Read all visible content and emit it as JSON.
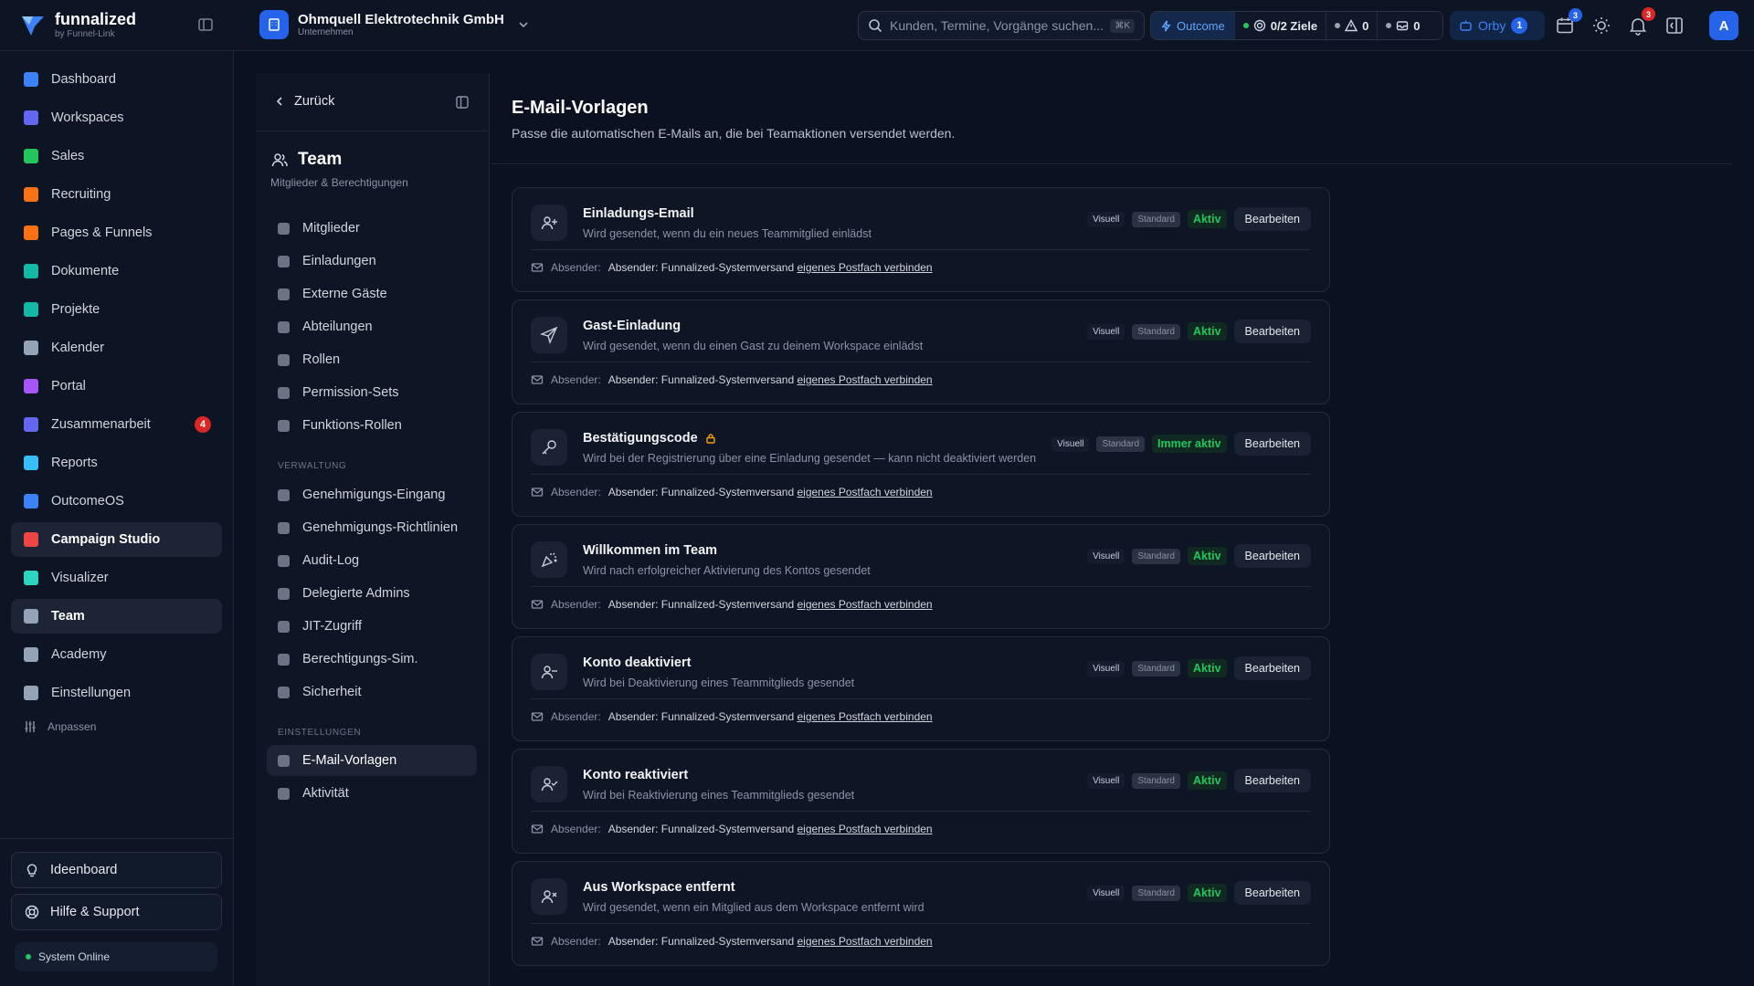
{
  "brand": {
    "name": "funnalized",
    "sub": "by Funnel-Link"
  },
  "company": {
    "name": "Ohmquell Elektrotechnik GmbH",
    "type": "Unternehmen"
  },
  "search": {
    "placeholder": "Kunden, Termine, Vorgänge suchen...",
    "shortcut": "⌘K"
  },
  "status": {
    "outcome_label": "Outcome",
    "goals": "0/2 Ziele",
    "warnings": "0",
    "messages": "0"
  },
  "orby": {
    "label": "Orby",
    "count": "1"
  },
  "top_badges": {
    "calendar": "3",
    "notifications": "3"
  },
  "user": {
    "avatar": "A"
  },
  "sidebar": {
    "items": [
      {
        "label": "Dashboard",
        "icon": "dashboard-icon",
        "color": "#3b82f6"
      },
      {
        "label": "Workspaces",
        "icon": "workspaces-icon",
        "color": "#6366f1"
      },
      {
        "label": "Sales",
        "icon": "sales-icon",
        "color": "#22c55e"
      },
      {
        "label": "Recruiting",
        "icon": "recruiting-icon",
        "color": "#f97316"
      },
      {
        "label": "Pages & Funnels",
        "icon": "funnel-icon",
        "color": "#f97316"
      },
      {
        "label": "Dokumente",
        "icon": "documents-icon",
        "color": "#14b8a6"
      },
      {
        "label": "Projekte",
        "icon": "projects-icon",
        "color": "#14b8a6"
      },
      {
        "label": "Kalender",
        "icon": "calendar-icon",
        "color": "#94a3b8"
      },
      {
        "label": "Portal",
        "icon": "portal-icon",
        "color": "#a855f7"
      },
      {
        "label": "Zusammenarbeit",
        "icon": "collaboration-icon",
        "color": "#6366f1",
        "badge": "4"
      },
      {
        "label": "Reports",
        "icon": "reports-icon",
        "color": "#38bdf8"
      },
      {
        "label": "OutcomeOS",
        "icon": "outcomeos-icon",
        "color": "#3b82f6"
      },
      {
        "label": "Campaign Studio",
        "icon": "flag-icon",
        "color": "#ef4444"
      },
      {
        "label": "Visualizer",
        "icon": "visualizer-icon",
        "color": "#2dd4bf"
      },
      {
        "label": "Team",
        "icon": "team-icon",
        "color": "#94a3b8"
      },
      {
        "label": "Academy",
        "icon": "academy-icon",
        "color": "#94a3b8"
      },
      {
        "label": "Einstellungen",
        "icon": "settings-icon",
        "color": "#94a3b8"
      }
    ],
    "customize": "Anpassen",
    "ideaboard": "Ideenboard",
    "help": "Hilfe & Support",
    "system_status": "System Online"
  },
  "subnav": {
    "back": "Zurück",
    "title": "Team",
    "subtitle": "Mitglieder & Berechtigungen",
    "team_items": [
      "Mitglieder",
      "Einladungen",
      "Externe Gäste",
      "Abteilungen",
      "Rollen",
      "Permission-Sets",
      "Funktions-Rollen"
    ],
    "section_admin": "VERWALTUNG",
    "admin_items": [
      "Genehmigungs-Eingang",
      "Genehmigungs-Richtlinien",
      "Audit-Log",
      "Delegierte Admins",
      "JIT-Zugriff",
      "Berechtigungs-Sim.",
      "Sicherheit"
    ],
    "section_settings": "EINSTELLUNGEN",
    "settings_items": [
      "E-Mail-Vorlagen",
      "Aktivität"
    ]
  },
  "page": {
    "title": "E-Mail-Vorlagen",
    "subtitle": "Passe die automatischen E-Mails an, die bei Teamaktionen versendet werden."
  },
  "templates": [
    {
      "title": "Einladungs-Email",
      "desc": "Wird gesendet, wenn du ein neues Teammitglied einlädst",
      "visual": "Visuell",
      "standard": "Standard",
      "status": "Aktiv",
      "edit": "Bearbeiten",
      "sender_label": "Absender:",
      "sender": "Absender: Funnalized-Systemversand",
      "connect": "eigenes Postfach verbinden",
      "icon": "user-plus-icon"
    },
    {
      "title": "Gast-Einladung",
      "desc": "Wird gesendet, wenn du einen Gast zu deinem Workspace einlädst",
      "visual": "Visuell",
      "standard": "Standard",
      "status": "Aktiv",
      "edit": "Bearbeiten",
      "sender_label": "Absender:",
      "sender": "Absender: Funnalized-Systemversand",
      "connect": "eigenes Postfach verbinden",
      "icon": "send-icon"
    },
    {
      "title": "Bestätigungscode",
      "desc": "Wird bei der Registrierung über eine Einladung gesendet — kann nicht deaktiviert werden",
      "visual": "Visuell",
      "standard": "Standard",
      "status": "Immer aktiv",
      "edit": "Bearbeiten",
      "sender_label": "Absender:",
      "sender": "Absender: Funnalized-Systemversand",
      "connect": "eigenes Postfach verbinden",
      "icon": "key-icon",
      "locked": true
    },
    {
      "title": "Willkommen im Team",
      "desc": "Wird nach erfolgreicher Aktivierung des Kontos gesendet",
      "visual": "Visuell",
      "standard": "Standard",
      "status": "Aktiv",
      "edit": "Bearbeiten",
      "sender_label": "Absender:",
      "sender": "Absender: Funnalized-Systemversand",
      "connect": "eigenes Postfach verbinden",
      "icon": "party-popper-icon"
    },
    {
      "title": "Konto deaktiviert",
      "desc": "Wird bei Deaktivierung eines Teammitglieds gesendet",
      "visual": "Visuell",
      "standard": "Standard",
      "status": "Aktiv",
      "edit": "Bearbeiten",
      "sender_label": "Absender:",
      "sender": "Absender: Funnalized-Systemversand",
      "connect": "eigenes Postfach verbinden",
      "icon": "user-minus-icon"
    },
    {
      "title": "Konto reaktiviert",
      "desc": "Wird bei Reaktivierung eines Teammitglieds gesendet",
      "visual": "Visuell",
      "standard": "Standard",
      "status": "Aktiv",
      "edit": "Bearbeiten",
      "sender_label": "Absender:",
      "sender": "Absender: Funnalized-Systemversand",
      "connect": "eigenes Postfach verbinden",
      "icon": "user-check-icon"
    },
    {
      "title": "Aus Workspace entfernt",
      "desc": "Wird gesendet, wenn ein Mitglied aus dem Workspace entfernt wird",
      "visual": "Visuell",
      "standard": "Standard",
      "status": "Aktiv",
      "edit": "Bearbeiten",
      "sender_label": "Absender:",
      "sender": "Absender: Funnalized-Systemversand",
      "connect": "eigenes Postfach verbinden",
      "icon": "user-x-icon"
    }
  ]
}
